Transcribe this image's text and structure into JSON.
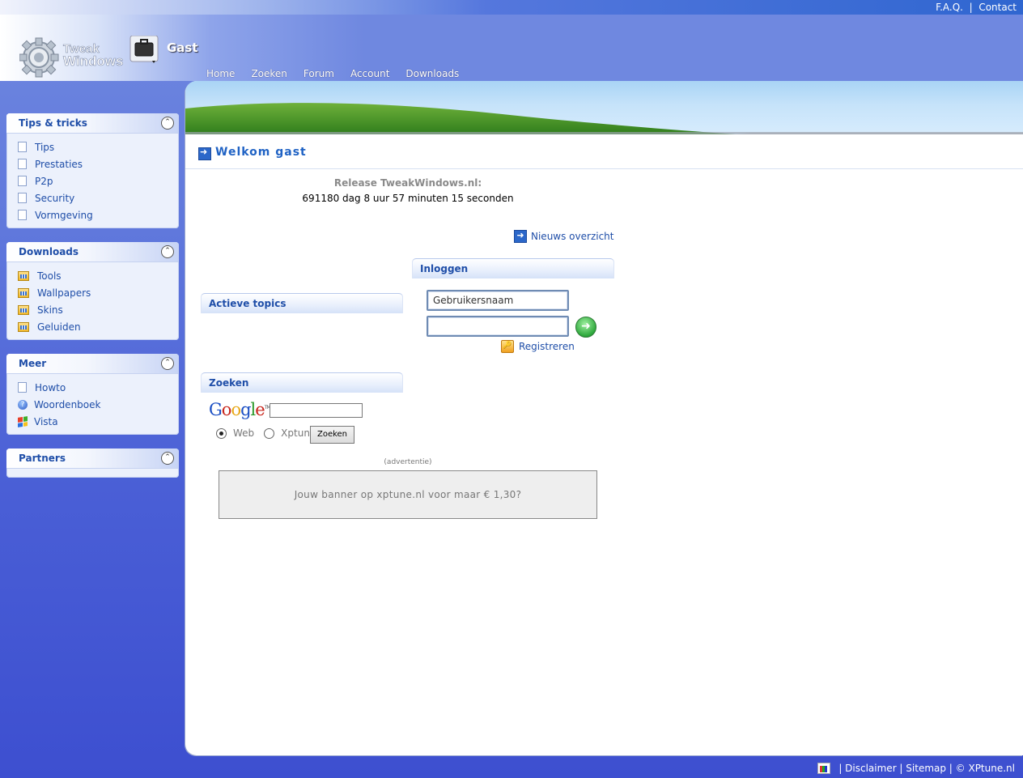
{
  "top_links": {
    "faq": "F.A.Q.",
    "separator": "|",
    "contact": "Contact"
  },
  "header": {
    "logo_line1": "Tweak",
    "logo_line2": "Windows",
    "user": "Gast",
    "nav": [
      "Home",
      "Zoeken",
      "Forum",
      "Account",
      "Downloads"
    ]
  },
  "sidebar": {
    "boxes": [
      {
        "title": "Tips & tricks",
        "items": [
          "Tips",
          "Prestaties",
          "P2p",
          "Security",
          "Vormgeving"
        ]
      },
      {
        "title": "Downloads",
        "items": [
          "Tools",
          "Wallpapers",
          "Skins",
          "Geluiden"
        ]
      },
      {
        "title": "Meer",
        "items": [
          "Howto",
          "Woordenboek",
          "Vista"
        ]
      },
      {
        "title": "Partners",
        "items": []
      }
    ],
    "collapse_symbol": "⌃"
  },
  "main": {
    "welcome": "Welkom gast",
    "release_label": "Release TweakWindows.nl:",
    "release_countdown": "691180 dag 8 uur 57 minuten 15 seconden",
    "news_link": "Nieuws overzicht",
    "active_topics_title": "Actieve topics",
    "login": {
      "title": "Inloggen",
      "username_value": "Gebruikersnaam",
      "password_value": "",
      "register": "Registreren"
    },
    "search": {
      "title": "Zoeken",
      "google_logo": "Google",
      "tm": "TM",
      "option_web": "Web",
      "option_xptune": "Xptune",
      "selected": "Web",
      "button": "Zoeken"
    },
    "ad_label": "(advertentie)",
    "ad_text": "Jouw banner op xptune.nl voor maar € 1,30?"
  },
  "footer": {
    "text": "| Disclaimer | Sitemap | © XPtune.nl"
  },
  "colors": {
    "link": "#1f4ea8",
    "accent": "#2b67c9",
    "background": "#4a5fd6"
  }
}
